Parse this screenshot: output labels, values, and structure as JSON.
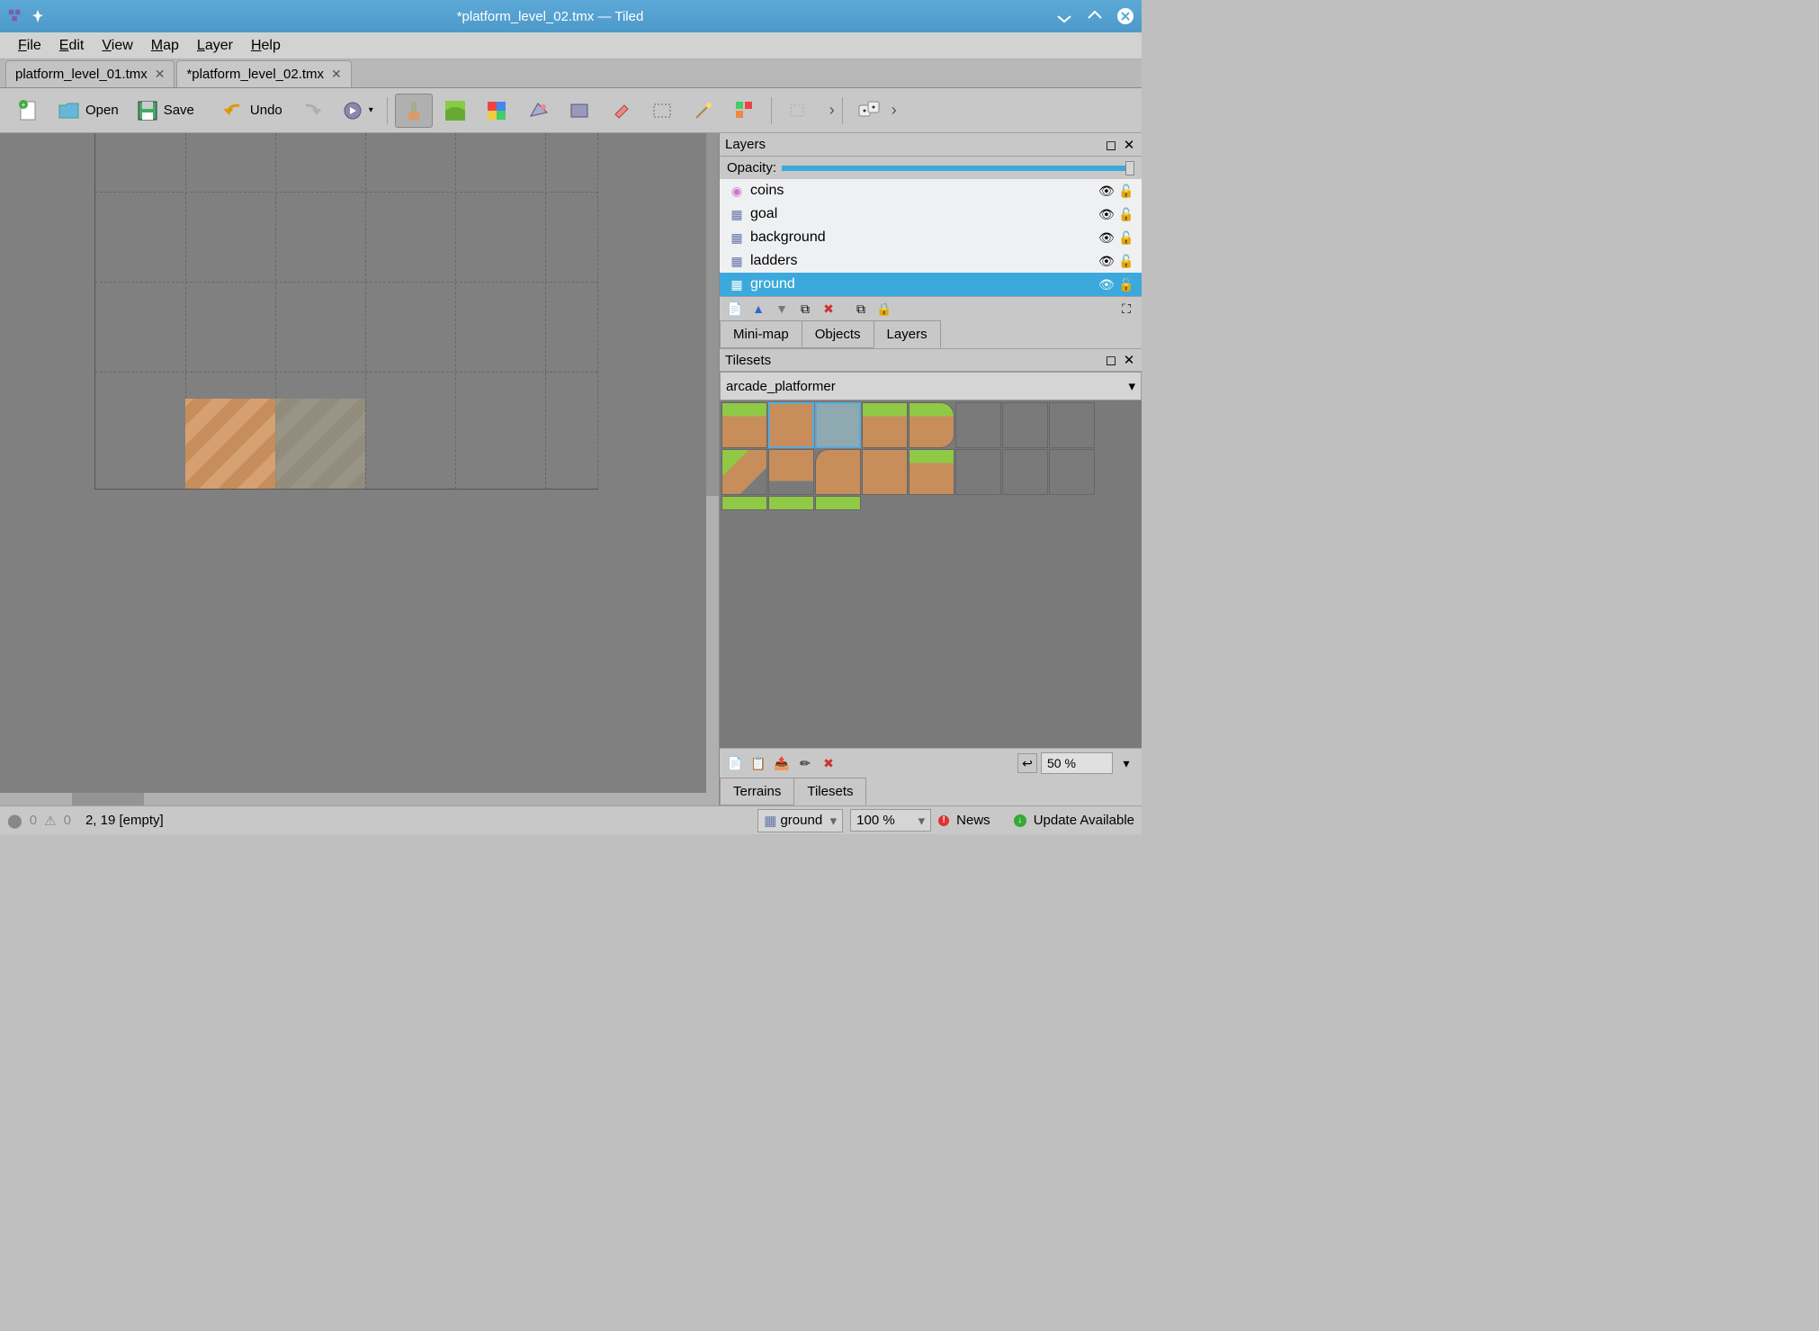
{
  "window_title": "*platform_level_02.tmx — Tiled",
  "menubar": [
    "File",
    "Edit",
    "View",
    "Map",
    "Layer",
    "Help"
  ],
  "filetabs": [
    {
      "name": "platform_level_01.tmx",
      "active": false
    },
    {
      "name": "*platform_level_02.tmx",
      "active": true
    }
  ],
  "toolbar": {
    "open": "Open",
    "save": "Save",
    "undo": "Undo"
  },
  "layers_panel": {
    "title": "Layers",
    "opacity_label": "Opacity:",
    "items": [
      {
        "name": "coins",
        "type": "object"
      },
      {
        "name": "goal",
        "type": "tile"
      },
      {
        "name": "background",
        "type": "tile"
      },
      {
        "name": "ladders",
        "type": "tile"
      },
      {
        "name": "ground",
        "type": "tile",
        "selected": true
      }
    ],
    "tabs": [
      "Mini-map",
      "Objects",
      "Layers"
    ],
    "active_tab": "Layers"
  },
  "tilesets_panel": {
    "title": "Tilesets",
    "selected_tileset": "arcade_platformer",
    "zoom": "50 %",
    "bottom_tabs": [
      "Terrains",
      "Tilesets"
    ],
    "active_tab": "Tilesets"
  },
  "statusbar": {
    "warnings": "0",
    "errors": "0",
    "coords": "2, 19 [empty]",
    "layer": "ground",
    "zoom": "100 %",
    "news": "News",
    "update": "Update Available"
  }
}
